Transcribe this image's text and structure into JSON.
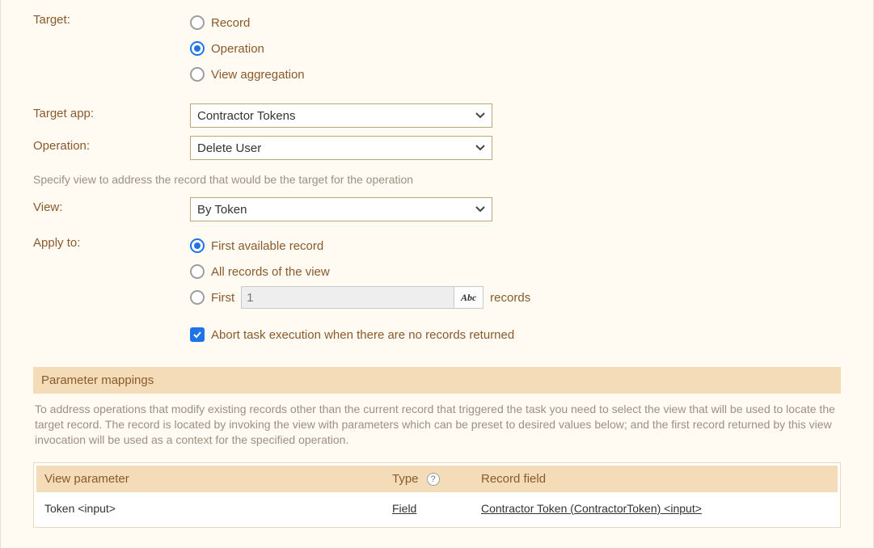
{
  "form": {
    "target": {
      "label": "Target:",
      "options": {
        "record": "Record",
        "operation": "Operation",
        "view_aggregation": "View aggregation"
      },
      "selected": "operation"
    },
    "target_app": {
      "label": "Target app:",
      "value": "Contractor Tokens"
    },
    "operation": {
      "label": "Operation:",
      "value": "Delete User"
    },
    "view_hint": "Specify view to address the record that would be the target for the operation",
    "view": {
      "label": "View:",
      "value": "By Token"
    },
    "apply_to": {
      "label": "Apply to:",
      "options": {
        "first_available": "First available record",
        "all_records": "All records of the view",
        "first_n_prefix": "First",
        "first_n_suffix": "records"
      },
      "selected": "first_available",
      "first_n_value": "1",
      "abc_label": "Abc"
    },
    "abort": {
      "checked": true,
      "label": "Abort task execution when there are no records returned"
    }
  },
  "parameter_mappings": {
    "title": "Parameter mappings",
    "description": "To address operations that modify existing records other than the current record that triggered the task you need to select the view that will be used to locate the target record. The record is located by invoking the view with parameters which can be preset to desired values below; and the first record returned by this view invocation will be used as a context for the specified operation.",
    "columns": {
      "view_parameter": "View parameter",
      "type": "Type",
      "record_field": "Record field"
    },
    "help_tooltip": "?",
    "rows": [
      {
        "view_parameter": "Token <input>",
        "type": "Field",
        "record_field": "Contractor Token (ContractorToken) <input>"
      }
    ]
  }
}
